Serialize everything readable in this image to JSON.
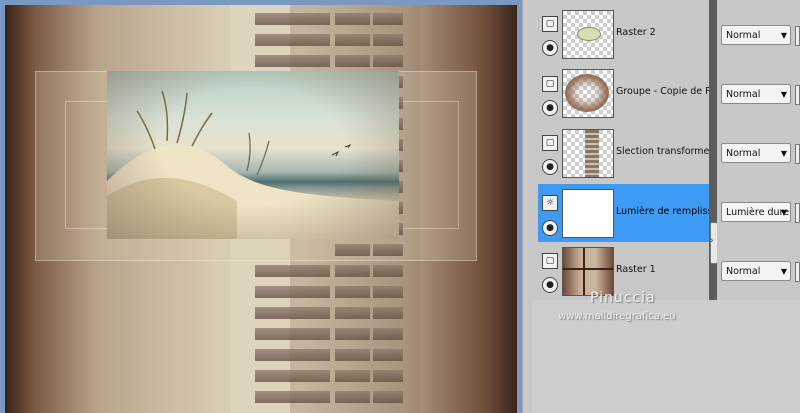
{
  "layers": [
    {
      "name": "Raster 2",
      "blend_mode": "Normal",
      "selected": false,
      "thumb": "sky-fragment"
    },
    {
      "name": "Groupe - Copie de Rast",
      "blend_mode": "Normal",
      "selected": false,
      "thumb": "brown-ellipse"
    },
    {
      "name": "Slection transforme",
      "blend_mode": "Normal",
      "selected": false,
      "thumb": "strip-column"
    },
    {
      "name": "Lumière de remplissage",
      "blend_mode": "Lumière dure",
      "selected": true,
      "thumb": "white-fill"
    },
    {
      "name": "Raster 1",
      "blend_mode": "Normal",
      "selected": false,
      "thumb": "brown-cross"
    }
  ],
  "icons": {
    "visibility": "eye-icon",
    "layer_type": "raster-layer-icon",
    "fill_type": "fill-light-icon",
    "caret": "dropdown-caret-icon"
  },
  "watermark": {
    "name": "Pinuccia",
    "url": "www.maildiregrafica.eu"
  },
  "colors": {
    "selected_row": "#3d9bf3",
    "panel_bg": "#c8c8c8",
    "canvas_border": "#7a98c4"
  }
}
